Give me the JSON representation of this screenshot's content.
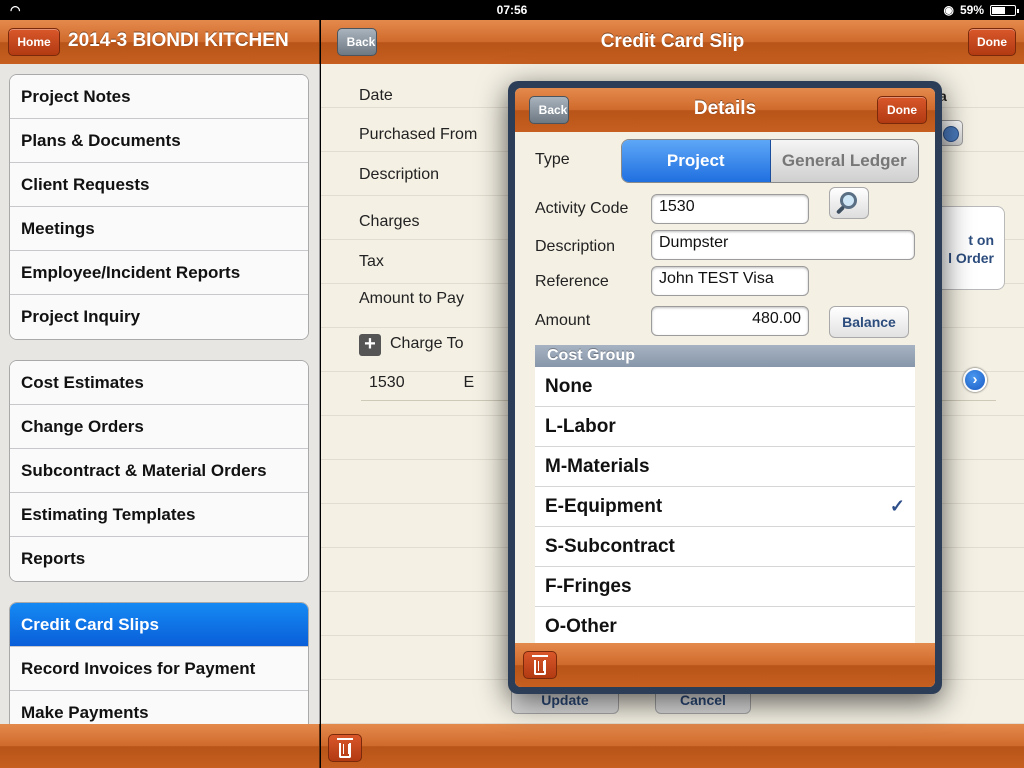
{
  "status_bar": {
    "time": "07:56",
    "battery": "59%",
    "battery_level": 0.59
  },
  "left": {
    "home_button": "Home",
    "title": "2014-3 BIONDI KITCHEN",
    "groups": [
      {
        "items": [
          {
            "label": "Project Notes"
          },
          {
            "label": "Plans & Documents"
          },
          {
            "label": "Client Requests"
          },
          {
            "label": "Meetings"
          },
          {
            "label": "Employee/Incident Reports"
          },
          {
            "label": "Project Inquiry"
          }
        ]
      },
      {
        "items": [
          {
            "label": "Cost Estimates"
          },
          {
            "label": "Change Orders"
          },
          {
            "label": "Subcontract & Material Orders"
          },
          {
            "label": "Estimating Templates"
          },
          {
            "label": "Reports"
          }
        ]
      },
      {
        "items": [
          {
            "label": "Credit Card Slips",
            "selected": true
          },
          {
            "label": "Record Invoices for Payment"
          },
          {
            "label": "Make Payments"
          }
        ]
      }
    ]
  },
  "right": {
    "back_button": "Back",
    "title": "Credit Card Slip",
    "done_button": "Done",
    "labels": {
      "date": "Date",
      "purchased_from": "Purchased From",
      "description": "Description",
      "charges": "Charges",
      "tax": "Tax",
      "amount_to_pay": "Amount to Pay",
      "charge_to": "Charge To"
    },
    "charge_row": {
      "code": "1530",
      "group": "E"
    },
    "fragments": {
      "a": "a",
      "card_line1": "t on",
      "card_line2": "l Order"
    },
    "update_button": "Update",
    "cancel_button": "Cancel"
  },
  "popover": {
    "back_button": "Back",
    "title": "Details",
    "done_button": "Done",
    "type_label": "Type",
    "type_options": [
      "Project",
      "General Ledger"
    ],
    "type_selected": "Project",
    "activity_code_label": "Activity Code",
    "activity_code_value": "1530",
    "description_label": "Description",
    "description_value": "Dumpster",
    "reference_label": "Reference",
    "reference_value": "John TEST Visa",
    "amount_label": "Amount",
    "amount_value": "480.00",
    "balance_button": "Balance",
    "cost_group_header": "Cost Group",
    "cost_groups": [
      {
        "label": "None"
      },
      {
        "label": "L-Labor"
      },
      {
        "label": "M-Materials"
      },
      {
        "label": "E-Equipment",
        "checked": true,
        "mark": "✓"
      },
      {
        "label": "S-Subcontract"
      },
      {
        "label": "F-Fringes"
      },
      {
        "label": "O-Other"
      }
    ]
  },
  "colors": {
    "toolbar": "#cf6a2b",
    "selected_row": "#0a5fd8",
    "segment_on": "#1f6fe0",
    "popover_frame": "#2c3e57"
  },
  "icons": [
    "wifi-icon",
    "lock-rotation-icon",
    "battery-icon",
    "magnifier-icon",
    "trash-icon",
    "plus-icon",
    "disclosure-arrow-icon",
    "clock-icon",
    "checkmark-icon"
  ]
}
